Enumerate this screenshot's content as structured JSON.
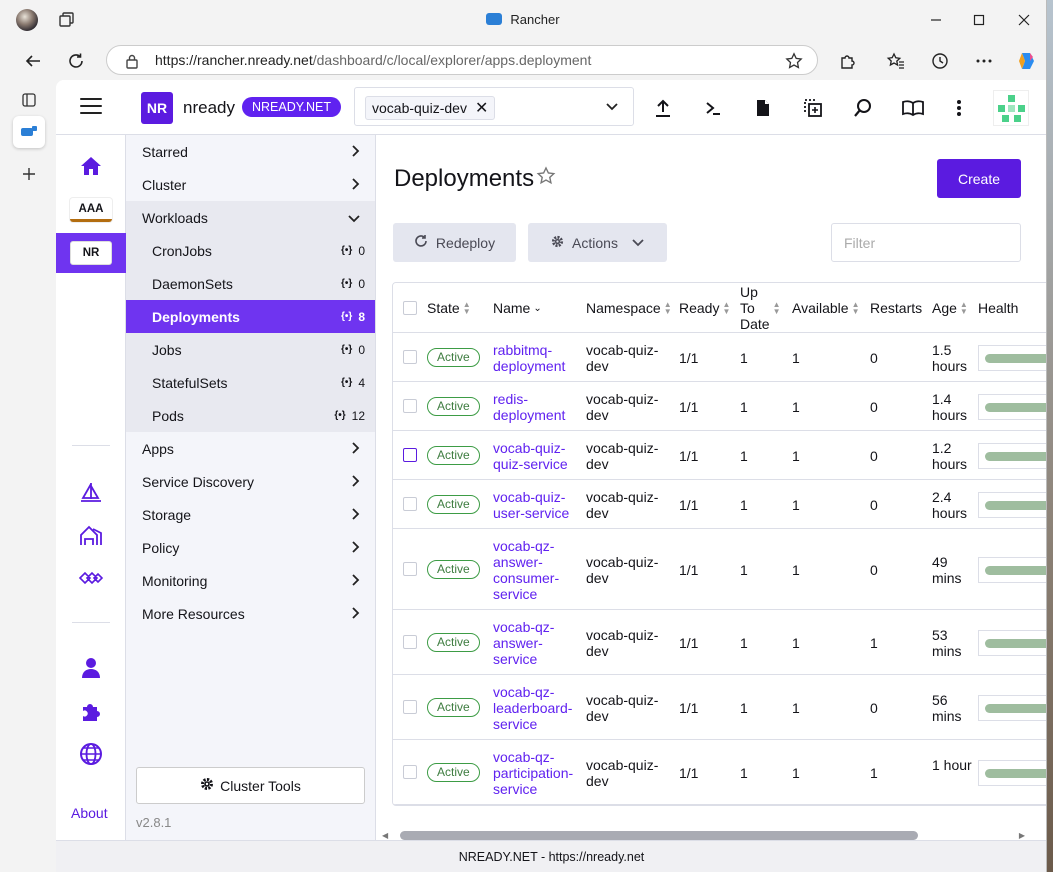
{
  "browser": {
    "tab_title": "Rancher",
    "url_host": "https://rancher.nready.net",
    "url_path": "/dashboard/c/local/explorer/apps.deployment"
  },
  "header": {
    "logo_text": "NR",
    "brand": "nready",
    "badge": "NREADY.NET",
    "namespace_chip": "vocab-quiz-dev"
  },
  "rail": {
    "cluster_aaa": "AAA",
    "cluster_nr": "NR",
    "about": "About"
  },
  "sidebar": {
    "items": [
      {
        "label": "Starred"
      },
      {
        "label": "Cluster"
      },
      {
        "label": "Workloads"
      },
      {
        "label": "CronJobs",
        "count": "0"
      },
      {
        "label": "DaemonSets",
        "count": "0"
      },
      {
        "label": "Deployments",
        "count": "8"
      },
      {
        "label": "Jobs",
        "count": "0"
      },
      {
        "label": "StatefulSets",
        "count": "4"
      },
      {
        "label": "Pods",
        "count": "12"
      },
      {
        "label": "Apps"
      },
      {
        "label": "Service Discovery"
      },
      {
        "label": "Storage"
      },
      {
        "label": "Policy"
      },
      {
        "label": "Monitoring"
      },
      {
        "label": "More Resources"
      }
    ],
    "cluster_tools": "Cluster Tools",
    "version": "v2.8.1"
  },
  "main": {
    "title": "Deployments",
    "create": "Create",
    "redeploy": "Redeploy",
    "actions": "Actions",
    "filter_placeholder": "Filter"
  },
  "table": {
    "headers": {
      "state": "State",
      "name": "Name",
      "namespace": "Namespace",
      "ready": "Ready",
      "uptodate": "Up To Date",
      "available": "Available",
      "restarts": "Restarts",
      "age": "Age",
      "health": "Health"
    },
    "rows": [
      {
        "state": "Active",
        "name": "rabbitmq-deployment",
        "namespace": "vocab-quiz-dev",
        "ready": "1/1",
        "uptodate": "1",
        "available": "1",
        "restarts": "0",
        "age": "1.5 hours"
      },
      {
        "state": "Active",
        "name": "redis-deployment",
        "namespace": "vocab-quiz-dev",
        "ready": "1/1",
        "uptodate": "1",
        "available": "1",
        "restarts": "0",
        "age": "1.4 hours"
      },
      {
        "state": "Active",
        "name": "vocab-quiz-quiz-service",
        "namespace": "vocab-quiz-dev",
        "ready": "1/1",
        "uptodate": "1",
        "available": "1",
        "restarts": "0",
        "age": "1.2 hours"
      },
      {
        "state": "Active",
        "name": "vocab-quiz-user-service",
        "namespace": "vocab-quiz-dev",
        "ready": "1/1",
        "uptodate": "1",
        "available": "1",
        "restarts": "0",
        "age": "2.4 hours"
      },
      {
        "state": "Active",
        "name": "vocab-qz-answer-consumer-service",
        "namespace": "vocab-quiz-dev",
        "ready": "1/1",
        "uptodate": "1",
        "available": "1",
        "restarts": "0",
        "age": "49 mins"
      },
      {
        "state": "Active",
        "name": "vocab-qz-answer-service",
        "namespace": "vocab-quiz-dev",
        "ready": "1/1",
        "uptodate": "1",
        "available": "1",
        "restarts": "1",
        "age": "53 mins"
      },
      {
        "state": "Active",
        "name": "vocab-qz-leaderboard-service",
        "namespace": "vocab-quiz-dev",
        "ready": "1/1",
        "uptodate": "1",
        "available": "1",
        "restarts": "0",
        "age": "56 mins"
      },
      {
        "state": "Active",
        "name": "vocab-qz-participation-service",
        "namespace": "vocab-quiz-dev",
        "ready": "1/1",
        "uptodate": "1",
        "available": "1",
        "restarts": "1",
        "age": "1 hour"
      }
    ]
  },
  "footer": {
    "text": "NREADY.NET - https://nready.net"
  }
}
